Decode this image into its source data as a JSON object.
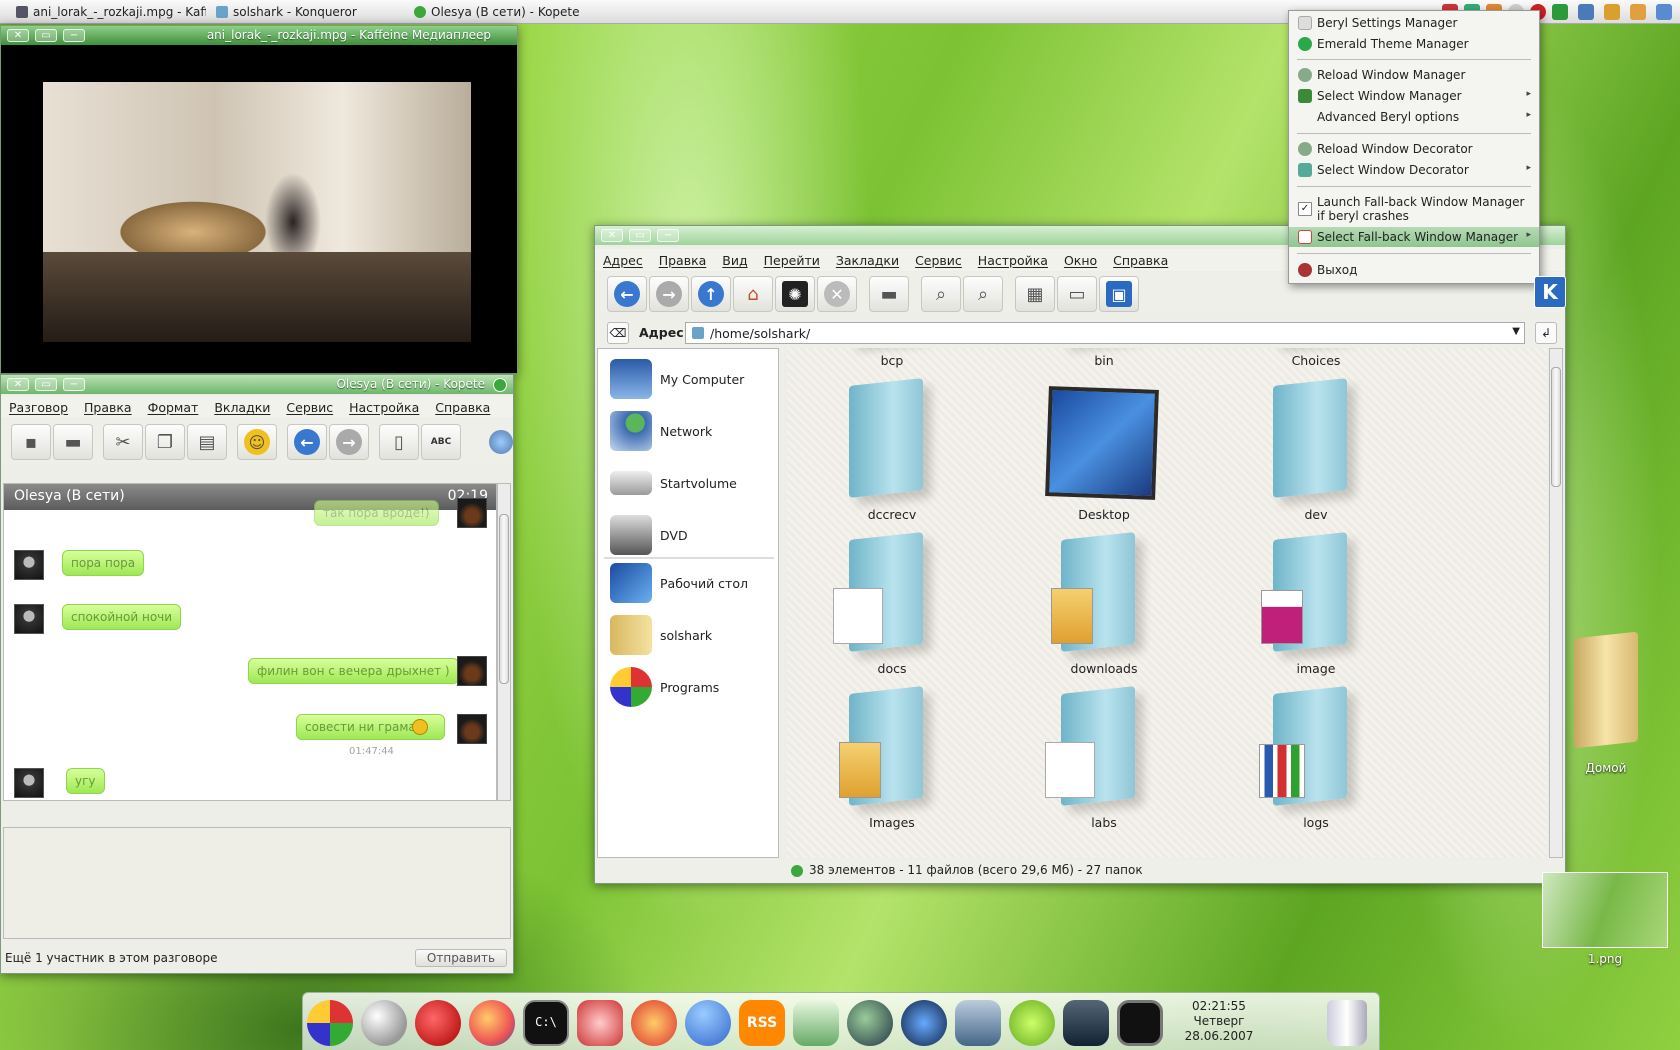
{
  "taskbar": {
    "tasks": [
      {
        "label": "ani_lorak_-_rozkaji.mpg - Kaffei"
      },
      {
        "label": "solshark - Konqueror"
      },
      {
        "label": "Olesya (В сети) - Kopete"
      }
    ]
  },
  "kaffeine": {
    "title": "ani_lorak_-_rozkaji.mpg - Kaffeine Медиаплеер"
  },
  "kopete": {
    "title": "Olesya (В сети) - Kopete",
    "menu": [
      "Разговор",
      "Правка",
      "Формат",
      "Вкладки",
      "Сервис",
      "Настройка",
      "Справка"
    ],
    "header_name": "Olesya (В сети)",
    "header_time": "02:19",
    "messages": [
      {
        "from": "me",
        "text": "так пора вроде!)"
      },
      {
        "from": "contact",
        "text": "пора пора"
      },
      {
        "from": "contact",
        "text": "спокойной ночи"
      },
      {
        "from": "me",
        "text": "филин вон с вечера дрыхнет )"
      },
      {
        "from": "me",
        "text": "совести ни грама"
      },
      {
        "from": "contact",
        "text": "угу"
      }
    ],
    "message_time": "01:47:44",
    "status_text": "Ещё 1 участник в этом разговоре",
    "send_label": "Отправить"
  },
  "konqueror": {
    "menu": [
      "Адрес",
      "Правка",
      "Вид",
      "Перейти",
      "Закладки",
      "Сервис",
      "Настройка",
      "Окно",
      "Справка"
    ],
    "address_label": "Адрес:",
    "address_value": "/home/solshark/",
    "sidebar": [
      {
        "label": "My Computer"
      },
      {
        "label": "Network"
      },
      {
        "label": "Startvolume"
      },
      {
        "label": "DVD"
      },
      {
        "label": "Рабочий стол"
      },
      {
        "label": "solshark"
      },
      {
        "label": "Programs"
      }
    ],
    "files": [
      {
        "label": "bcp"
      },
      {
        "label": "bin"
      },
      {
        "label": "Choices"
      },
      {
        "label": "dccrecv"
      },
      {
        "label": "Desktop"
      },
      {
        "label": "dev"
      },
      {
        "label": "docs"
      },
      {
        "label": "downloads"
      },
      {
        "label": "image"
      },
      {
        "label": "Images"
      },
      {
        "label": "labs"
      },
      {
        "label": "logs"
      }
    ],
    "status": "38 элементов - 11 файлов (всего 29,6 Мб) - 27 папок"
  },
  "beryl_menu": {
    "items": [
      {
        "label": "Beryl Settings Manager"
      },
      {
        "label": "Emerald Theme Manager"
      },
      {
        "label": "Reload Window Manager"
      },
      {
        "label": "Select Window Manager"
      },
      {
        "label": "Advanced Beryl options"
      },
      {
        "label": "Reload Window Decorator"
      },
      {
        "label": "Select Window Decorator"
      },
      {
        "label": "Launch Fall-back Window Manager if beryl crashes"
      },
      {
        "label": "Select Fall-back Window Manager"
      },
      {
        "label": "Выход"
      }
    ]
  },
  "desktop": {
    "icons": [
      {
        "label": "Домой"
      },
      {
        "label": "1.png"
      }
    ]
  },
  "dock": {
    "time": "02:21:55",
    "day": "Четверг",
    "date": "28.06.2007",
    "rss_label": "RSS"
  },
  "colors": {
    "title_green": "#6fb56c",
    "bubble_green": "#9fe854",
    "status_online": "#3aa83a"
  }
}
